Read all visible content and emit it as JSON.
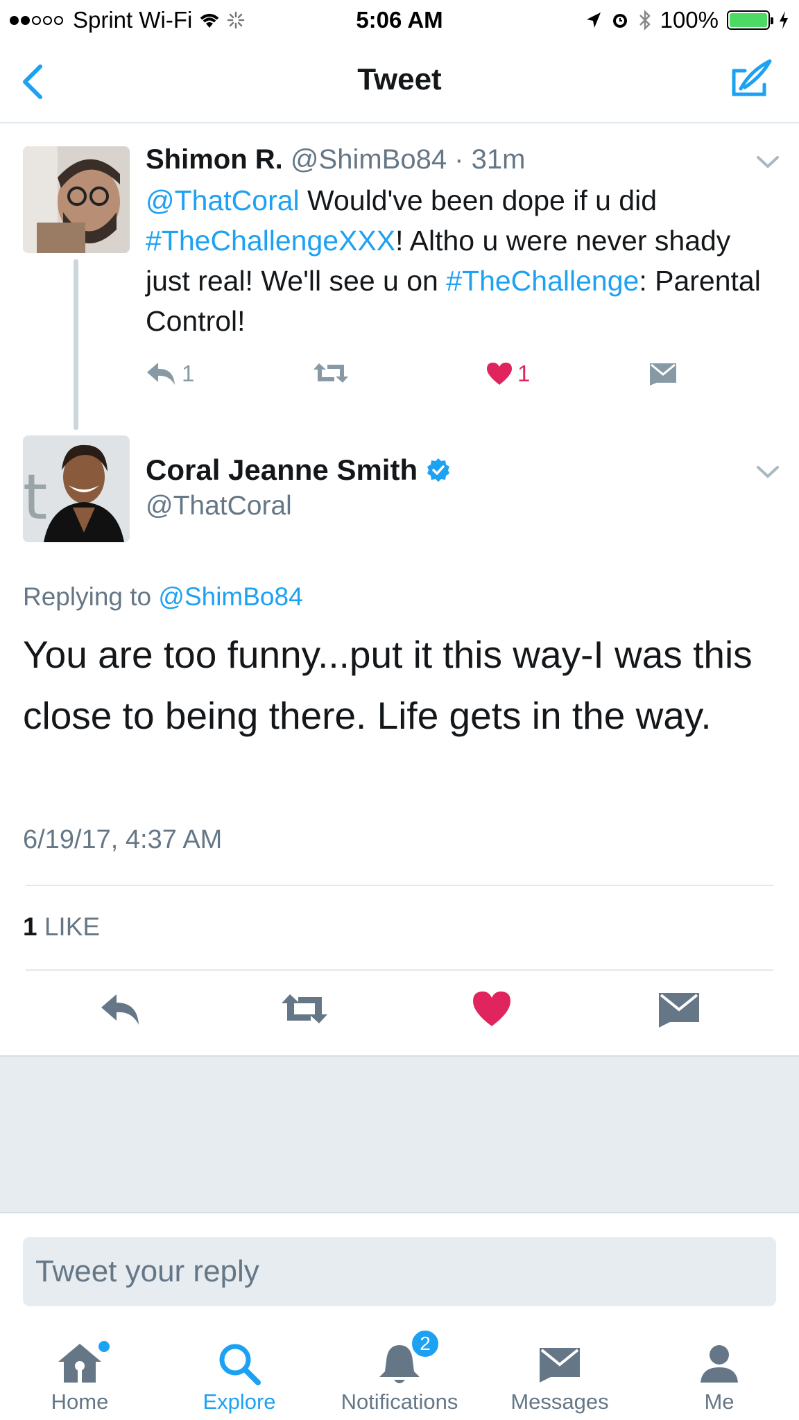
{
  "status_bar": {
    "carrier": "Sprint Wi-Fi",
    "time": "5:06 AM",
    "battery": "100%"
  },
  "nav": {
    "title": "Tweet"
  },
  "parent_tweet": {
    "name": "Shimon R.",
    "handle": "@ShimBo84",
    "age": "31m",
    "segments": [
      {
        "text": "@ThatCoral",
        "link": true
      },
      {
        "text": " Would've been dope if u did ",
        "link": false
      },
      {
        "text": "#TheChallengeXXX",
        "link": true
      },
      {
        "text": "! Altho u were never shady just real! We'll see u on ",
        "link": false
      },
      {
        "text": "#TheChallenge",
        "link": true
      },
      {
        "text": ": Parental Control!",
        "link": false
      }
    ],
    "reply_count": "1",
    "like_count": "1"
  },
  "main_tweet": {
    "name": "Coral Jeanne Smith",
    "handle": "@ThatCoral",
    "replying_prefix": "Replying to ",
    "replying_handle": "@ShimBo84",
    "text": "You are too funny...put it this way-I was this close to being there. Life gets in the way.",
    "timestamp": "6/19/17, 4:37 AM",
    "like_count": "1",
    "like_label": "LIKE"
  },
  "reply": {
    "placeholder": "Tweet your reply"
  },
  "tabs": [
    {
      "label": "Home",
      "icon": "home-icon"
    },
    {
      "label": "Explore",
      "icon": "search-icon"
    },
    {
      "label": "Notifications",
      "icon": "bell-icon"
    },
    {
      "label": "Messages",
      "icon": "envelope-icon"
    },
    {
      "label": "Me",
      "icon": "person-icon"
    }
  ],
  "notifications_badge": "2",
  "colors": {
    "accent": "#1da1f2",
    "like": "#e0245e",
    "muted": "#657786",
    "battery": "#4cd964"
  }
}
